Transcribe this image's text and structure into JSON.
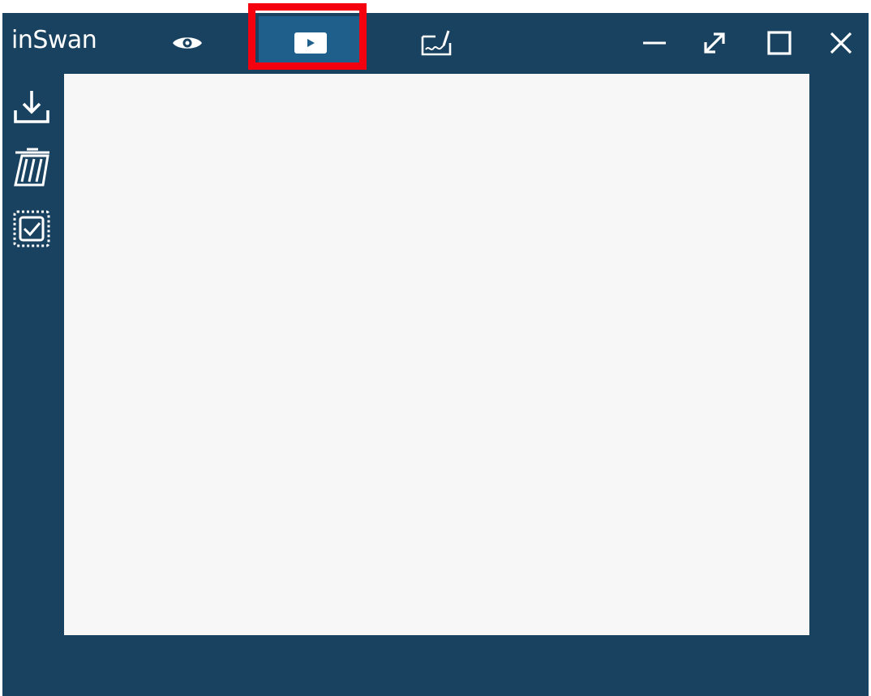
{
  "app": {
    "brand": "inSwan"
  },
  "toolbar": {
    "items": [
      {
        "name": "preview",
        "icon": "eye-icon"
      },
      {
        "name": "play",
        "icon": "play-icon",
        "active": true
      },
      {
        "name": "sign",
        "icon": "signature-pad-icon"
      }
    ]
  },
  "window_controls": {
    "items": [
      {
        "name": "minimize",
        "icon": "minimize-icon"
      },
      {
        "name": "expand",
        "icon": "expand-arrow-icon"
      },
      {
        "name": "maximize",
        "icon": "maximize-icon"
      },
      {
        "name": "close",
        "icon": "close-icon"
      }
    ]
  },
  "sidebar": {
    "items": [
      {
        "name": "download",
        "icon": "download-icon"
      },
      {
        "name": "delete",
        "icon": "trash-icon"
      },
      {
        "name": "select-all",
        "icon": "select-checkbox-icon"
      }
    ]
  },
  "colors": {
    "window_bg": "#18425f",
    "active_tab_bg": "#1f5f8b",
    "canvas_bg": "#f7f7f7",
    "highlight": "#f5000f",
    "icon": "#ffffff"
  }
}
